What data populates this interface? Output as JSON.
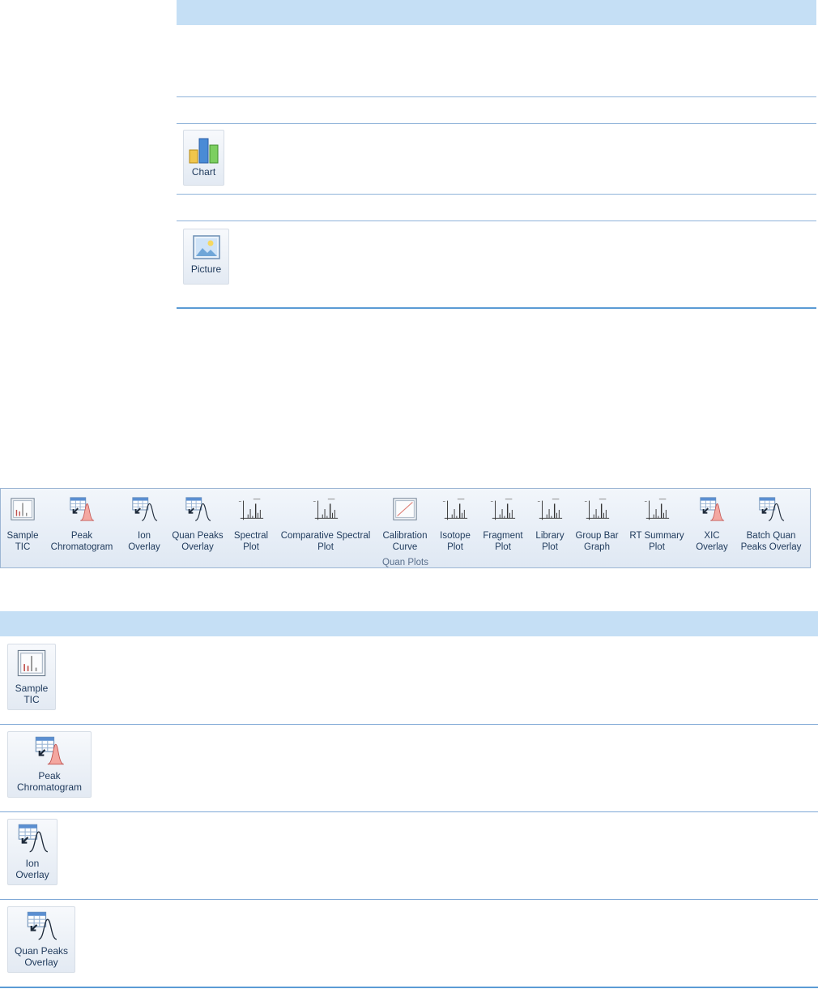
{
  "top_table": {
    "chart_button_label": "Chart",
    "picture_button_label": "Picture"
  },
  "ribbon": {
    "group_label": "Quan Plots",
    "items": [
      {
        "label": "Sample\nTIC",
        "icon": "sample-tic-icon"
      },
      {
        "label": "Peak\nChromatogram",
        "icon": "peak-chromatogram-icon"
      },
      {
        "label": "Ion\nOverlay",
        "icon": "ion-overlay-icon"
      },
      {
        "label": "Quan Peaks\nOverlay",
        "icon": "quan-peaks-overlay-icon"
      },
      {
        "label": "Spectral\nPlot",
        "icon": "spectral-plot-icon"
      },
      {
        "label": "Comparative Spectral\nPlot",
        "icon": "comparative-spectral-plot-icon"
      },
      {
        "label": "Calibration\nCurve",
        "icon": "calibration-curve-icon"
      },
      {
        "label": "Isotope\nPlot",
        "icon": "isotope-plot-icon"
      },
      {
        "label": "Fragment\nPlot",
        "icon": "fragment-plot-icon"
      },
      {
        "label": "Library\nPlot",
        "icon": "library-plot-icon"
      },
      {
        "label": "Group Bar\nGraph",
        "icon": "group-bar-graph-icon"
      },
      {
        "label": "RT Summary\nPlot",
        "icon": "rt-summary-plot-icon"
      },
      {
        "label": "XIC\nOverlay",
        "icon": "xic-overlay-icon"
      },
      {
        "label": "Batch Quan\nPeaks Overlay",
        "icon": "batch-quan-peaks-overlay-icon"
      }
    ]
  },
  "bottom_table": {
    "rows": [
      {
        "label": "Sample\nTIC"
      },
      {
        "label": "Peak\nChromatogram"
      },
      {
        "label": "Ion\nOverlay"
      },
      {
        "label": "Quan Peaks\nOverlay"
      }
    ]
  },
  "colors": {
    "header_band": "#c5dff5",
    "rule": "#8fb3d9",
    "peak_fill": "#f4a7a0"
  }
}
